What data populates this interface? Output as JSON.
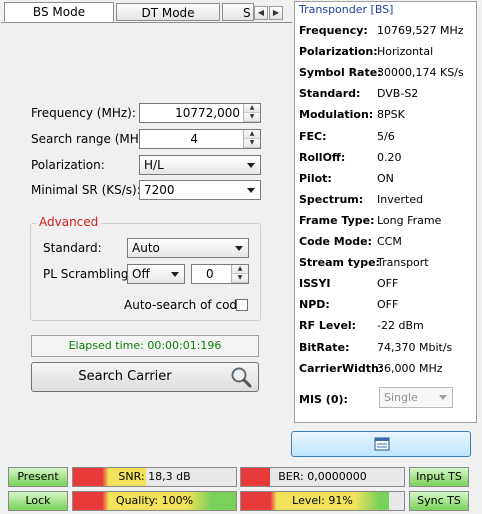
{
  "tabs": [
    {
      "label": "BS Mode",
      "active": true
    },
    {
      "label": "DT Mode",
      "active": false
    },
    {
      "label": "S",
      "active": false
    }
  ],
  "form": {
    "frequency_label": "Frequency (MHz):",
    "frequency_value": "10772,000",
    "search_range_label": "Search range (MHz):",
    "search_range_value": "4",
    "polarization_label": "Polarization:",
    "polarization_value": "H/L",
    "min_sr_label": "Minimal SR (KS/s):",
    "min_sr_value": "7200"
  },
  "advanced": {
    "title": "Advanced",
    "standard_label": "Standard:",
    "standard_value": "Auto",
    "pl_label": "PL Scrambling:",
    "pl_value": "Off",
    "pl_number": "0",
    "autosearch_label": "Auto-search of code",
    "autosearch_checked": false
  },
  "elapsed": "Elapsed time: 00:00:01:196",
  "search_button": "Search Carrier",
  "transponder": {
    "title": "Transponder [BS]",
    "rows": [
      {
        "label": "Frequency:",
        "value": "10769,527 MHz"
      },
      {
        "label": "Polarization:",
        "value": "Horizontal"
      },
      {
        "label": "Symbol Rate:",
        "value": "30000,174 KS/s"
      },
      {
        "label": "Standard:",
        "value": "DVB-S2"
      },
      {
        "label": "Modulation:",
        "value": "8PSK"
      },
      {
        "label": "FEC:",
        "value": "5/6"
      },
      {
        "label": "RollOff:",
        "value": "0.20"
      },
      {
        "label": "Pilot:",
        "value": "ON"
      },
      {
        "label": "Spectrum:",
        "value": "Inverted"
      },
      {
        "label": "Frame Type:",
        "value": "Long Frame"
      },
      {
        "label": "Code Mode:",
        "value": "CCM"
      },
      {
        "label": "Stream type:",
        "value": "Transport"
      },
      {
        "label": "ISSYI",
        "value": "OFF"
      },
      {
        "label": "NPD:",
        "value": "OFF"
      },
      {
        "label": "RF Level:",
        "value": "-22 dBm"
      },
      {
        "label": "BitRate:",
        "value": "74,370 Mbit/s"
      },
      {
        "label": "CarrierWidth:",
        "value": "36,000 MHz"
      }
    ],
    "mis_label": "MIS (0):",
    "mis_value": "Single"
  },
  "status": {
    "present": "Present",
    "lock": "Lock",
    "input_ts": "Input TS",
    "sync_ts": "Sync TS",
    "snr": {
      "text": "SNR: 18,3 dB",
      "level": 0.45
    },
    "ber": {
      "text": "BER: 0,0000000",
      "level": 0.18
    },
    "quality": {
      "text": "Quality: 100%",
      "level": 1.0
    },
    "rflevel": {
      "text": "Level: 91%",
      "level": 0.91
    }
  },
  "colors": {
    "accent_title": "#1c3f9c",
    "advanced_title": "#d02020",
    "elapsed_text": "#0a7d0a",
    "green": "#7ad15a",
    "red": "#e83a3a",
    "yellow": "#f1e25a"
  },
  "icons": {
    "search": "magnifier-icon",
    "transponder_button": "window-icon"
  }
}
